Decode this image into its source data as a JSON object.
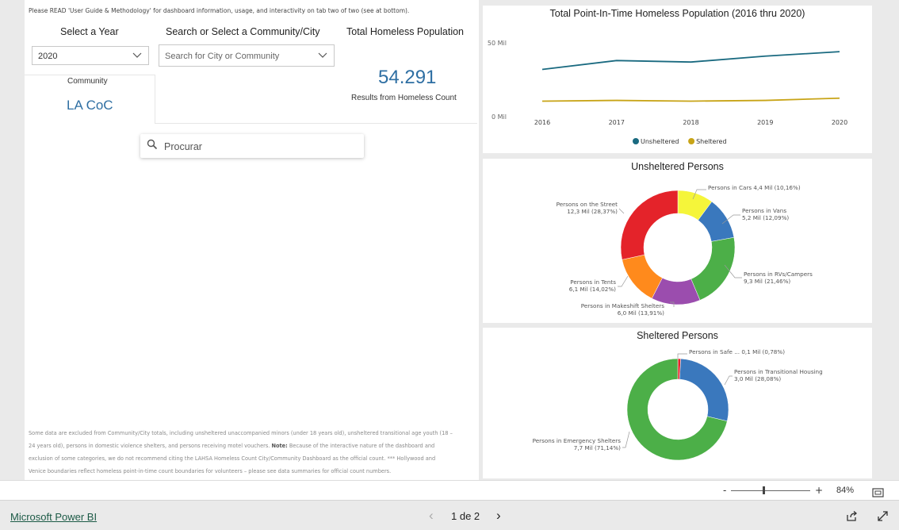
{
  "notice": "Please READ 'User Guide & Methodology' for dashboard information, usage, and interactivity on tab two of two (see at bottom).",
  "filters": {
    "year_label": "Select a Year",
    "year_value": "2020",
    "community_label": "Search or Select a Community/City",
    "community_placeholder": "Search for City or Community"
  },
  "kpi": {
    "label": "Total Homeless Population",
    "value": "54.291",
    "caption": "Results from Homeless Count"
  },
  "community_card": {
    "label": "Community",
    "value": "LA CoC"
  },
  "search": {
    "placeholder": "Procurar"
  },
  "footnote": {
    "line1": "Some data are excluded from Community/City totals, including unsheltered unaccompanied minors (under 18 years old), unsheltered transitional age youth (18 –",
    "line2a": "24 years old), persons in domestic violence shelters, and persons receiving motel vouchers.",
    "line2b": "Note:",
    "line2c": "Because of the interactive nature of the dashboard and",
    "line3": "exclusion of some categories, we do not recommend citing the LAHSA Homeless Count City/Community Dashboard as the official count. *** Hollywood and",
    "line4": "Venice boundaries reflect homeless point-in-time count boundaries for volunteers – please see data summaries for official count numbers."
  },
  "chart_data": [
    {
      "type": "line",
      "title": "Total Point-In-Time Homeless Population (2016 thru 2020)",
      "x": [
        "2016",
        "2017",
        "2018",
        "2019",
        "2020"
      ],
      "y_ticks": [
        "0 Mil",
        "50 Mil"
      ],
      "ylim": [
        0,
        50
      ],
      "series": [
        {
          "name": "Unsheltered",
          "color": "#1a6a80",
          "values": [
            32,
            38,
            37,
            41,
            44
          ]
        },
        {
          "name": "Sheltered",
          "color": "#c8a417",
          "values": [
            10.5,
            11,
            10.5,
            11,
            12.5
          ]
        }
      ],
      "legend_position": "bottom"
    },
    {
      "type": "pie",
      "title": "Unsheltered Persons",
      "slices": [
        {
          "name": "Persons in Cars",
          "value": 4.4,
          "value_label": "4,4 Mil",
          "percent": "10,16%",
          "color": "#f5f53a"
        },
        {
          "name": "Persons in Vans",
          "value": 5.2,
          "value_label": "5,2 Mil",
          "percent": "12,09%",
          "color": "#3a78bd"
        },
        {
          "name": "Persons in RVs/Campers",
          "value": 9.3,
          "value_label": "9,3 Mil",
          "percent": "21,46%",
          "color": "#4caf48"
        },
        {
          "name": "Persons in Makeshift Shelters",
          "value": 6.0,
          "value_label": "6,0 Mil",
          "percent": "13,91%",
          "color": "#9b4dae"
        },
        {
          "name": "Persons in Tents",
          "value": 6.1,
          "value_label": "6,1 Mil",
          "percent": "14,02%",
          "color": "#ff8a1c"
        },
        {
          "name": "Persons on the Street",
          "value": 12.3,
          "value_label": "12,3 Mil",
          "percent": "28,37%",
          "color": "#e4232a"
        }
      ]
    },
    {
      "type": "pie",
      "title": "Sheltered Persons",
      "slices": [
        {
          "name": "Persons in Safe ...",
          "value": 0.1,
          "value_label": "0,1 Mil",
          "percent": "0,78%",
          "color": "#e4232a"
        },
        {
          "name": "Persons in Transitional Housing",
          "value": 3.0,
          "value_label": "3,0 Mil",
          "percent": "28,08%",
          "color": "#3a78bd"
        },
        {
          "name": "Persons in Emergency Shelters",
          "value": 7.7,
          "value_label": "7,7 Mil",
          "percent": "71,14%",
          "color": "#4caf48"
        }
      ]
    }
  ],
  "zoom": {
    "minus": "-",
    "plus": "+",
    "level": "84%"
  },
  "footer": {
    "brand": "Microsoft Power BI",
    "page_indicator": "1 de 2",
    "prev": "‹",
    "next": "›"
  },
  "icons": [
    "search-icon",
    "chevron-down-icon",
    "fit-to-page-icon",
    "share-icon",
    "fullscreen-icon"
  ]
}
